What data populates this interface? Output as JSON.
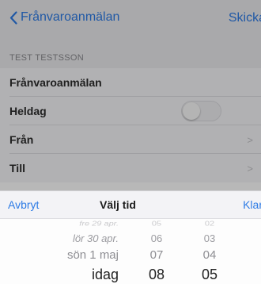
{
  "navbar": {
    "back_label": "Frånvaroanmälan",
    "action_label": "Skicka"
  },
  "section": {
    "header": "TEST TESTSSON"
  },
  "rows": {
    "title": "Frånvaroanmälan",
    "allday": "Heldag",
    "allday_on": false,
    "from": "Från",
    "to": "Till"
  },
  "picker_toolbar": {
    "cancel_label": "Avbryt",
    "title": "Välj tid",
    "done_label": "Klar"
  },
  "picker": {
    "rows": [
      {
        "date": "fre 29 apr.",
        "hour": "05",
        "minute": "02"
      },
      {
        "date": "lör 30 apr.",
        "hour": "06",
        "minute": "03"
      },
      {
        "date": "sön 1 maj",
        "hour": "07",
        "minute": "04"
      },
      {
        "date": "idag",
        "hour": "08",
        "minute": "05"
      }
    ]
  },
  "colors": {
    "accent": "#2d7be5"
  }
}
